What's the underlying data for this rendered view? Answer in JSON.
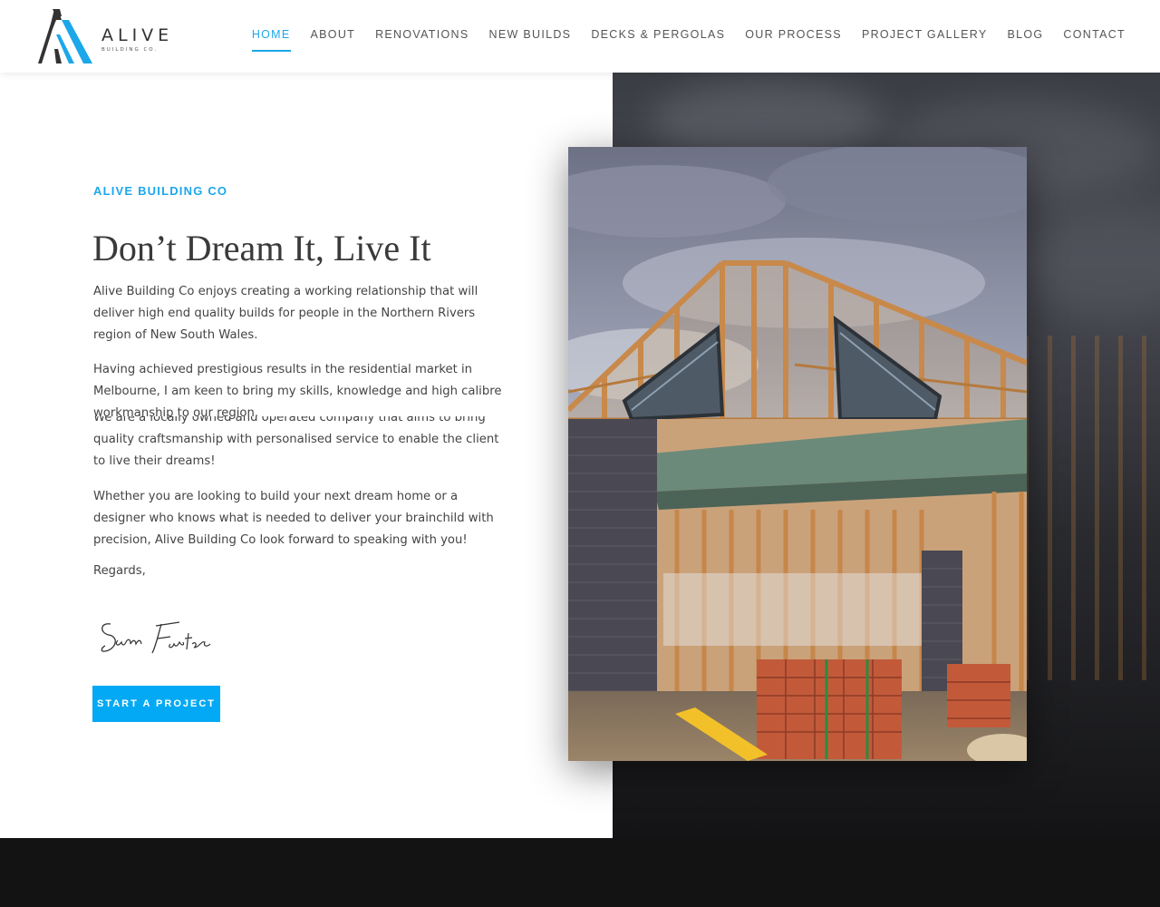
{
  "header": {
    "logo": {
      "word": "ALIVE",
      "sub": "BUILDING CO."
    },
    "nav": [
      {
        "label": "HOME",
        "active": true
      },
      {
        "label": "ABOUT"
      },
      {
        "label": "RENOVATIONS"
      },
      {
        "label": "NEW BUILDS"
      },
      {
        "label": "DECKS & PERGOLAS"
      },
      {
        "label": "OUR PROCESS"
      },
      {
        "label": "PROJECT GALLERY"
      },
      {
        "label": "BLOG"
      },
      {
        "label": "CONTACT"
      }
    ]
  },
  "hero": {
    "eyebrow": "ALIVE BUILDING CO",
    "headline": "Don’t Dream It, Live It",
    "p1": "Alive Building Co enjoys creating a working relationship that will deliver high end quality builds for people in the Northern Rivers region of New South Wales.",
    "p2": "Having achieved prestigious results in the residential market in Melbourne, I am keen to bring my skills, knowledge and high calibre workmanship to our region.",
    "p3": "We are a locally owned and operated company that aims to bring quality craftsmanship with personalised service to enable the client to live their dreams!",
    "p4": "Whether you are looking to build your next dream home or a designer who knows what is needed to deliver your brainchild with precision, Alive Building Co look forward to speaking with you!",
    "regards": "Regards,",
    "signature": "Sam Foster",
    "cta": "START A PROJECT"
  },
  "colors": {
    "accent": "#1ca7ea",
    "cta": "#03a9f4",
    "footer": "#131313"
  }
}
